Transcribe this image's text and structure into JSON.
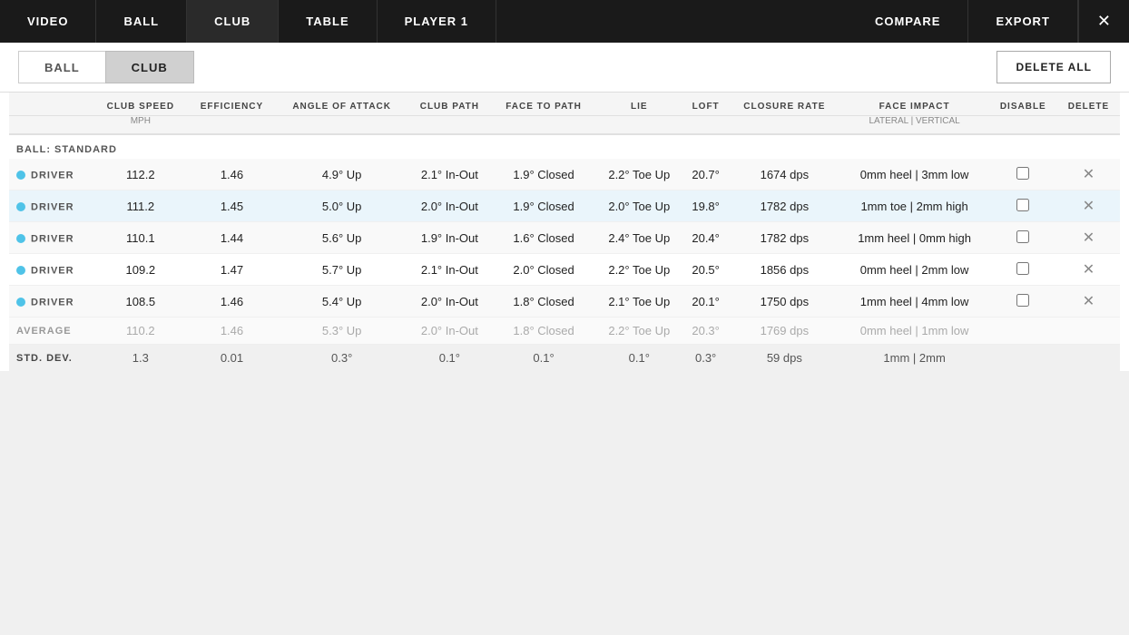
{
  "nav": {
    "items": [
      {
        "label": "VIDEO",
        "active": false
      },
      {
        "label": "BALL",
        "active": false
      },
      {
        "label": "CLUB",
        "active": true
      },
      {
        "label": "TABLE",
        "active": false
      },
      {
        "label": "PLAYER 1",
        "active": false
      }
    ],
    "right_items": [
      {
        "label": "COMPARE"
      },
      {
        "label": "EXPORT"
      }
    ],
    "close_symbol": "✕"
  },
  "sub_nav": {
    "tabs": [
      {
        "label": "BALL",
        "active": false
      },
      {
        "label": "CLUB",
        "active": true
      }
    ],
    "delete_all": "DELETE ALL"
  },
  "table": {
    "columns": [
      {
        "label": "",
        "unit": ""
      },
      {
        "label": "CLUB SPEED",
        "unit": "MPH"
      },
      {
        "label": "EFFICIENCY",
        "unit": ""
      },
      {
        "label": "ANGLE OF ATTACK",
        "unit": ""
      },
      {
        "label": "CLUB PATH",
        "unit": ""
      },
      {
        "label": "FACE TO PATH",
        "unit": ""
      },
      {
        "label": "LIE",
        "unit": ""
      },
      {
        "label": "LOFT",
        "unit": ""
      },
      {
        "label": "CLOSURE RATE",
        "unit": ""
      },
      {
        "label": "FACE IMPACT",
        "unit": "LATERAL | VERTICAL"
      },
      {
        "label": "DISABLE",
        "unit": ""
      },
      {
        "label": "DELETE",
        "unit": ""
      }
    ],
    "section_label": "BALL: STANDARD",
    "rows": [
      {
        "highlighted": false,
        "dot": true,
        "club": "DRIVER",
        "club_speed": "112.2",
        "efficiency": "1.46",
        "angle_of_attack": "4.9° Up",
        "club_path": "2.1° In-Out",
        "face_to_path": "1.9° Closed",
        "lie": "2.2° Toe Up",
        "loft": "20.7°",
        "closure_rate": "1674 dps",
        "face_impact": "0mm heel | 3mm low"
      },
      {
        "highlighted": true,
        "dot": true,
        "club": "DRIVER",
        "club_speed": "111.2",
        "efficiency": "1.45",
        "angle_of_attack": "5.0° Up",
        "club_path": "2.0° In-Out",
        "face_to_path": "1.9° Closed",
        "lie": "2.0° Toe Up",
        "loft": "19.8°",
        "closure_rate": "1782 dps",
        "face_impact": "1mm toe | 2mm high"
      },
      {
        "highlighted": false,
        "dot": true,
        "club": "DRIVER",
        "club_speed": "110.1",
        "efficiency": "1.44",
        "angle_of_attack": "5.6° Up",
        "club_path": "1.9° In-Out",
        "face_to_path": "1.6° Closed",
        "lie": "2.4° Toe Up",
        "loft": "20.4°",
        "closure_rate": "1782 dps",
        "face_impact": "1mm heel | 0mm high"
      },
      {
        "highlighted": false,
        "dot": true,
        "club": "DRIVER",
        "club_speed": "109.2",
        "efficiency": "1.47",
        "angle_of_attack": "5.7° Up",
        "club_path": "2.1° In-Out",
        "face_to_path": "2.0° Closed",
        "lie": "2.2° Toe Up",
        "loft": "20.5°",
        "closure_rate": "1856 dps",
        "face_impact": "0mm heel | 2mm low"
      },
      {
        "highlighted": false,
        "dot": true,
        "club": "DRIVER",
        "club_speed": "108.5",
        "efficiency": "1.46",
        "angle_of_attack": "5.4° Up",
        "club_path": "2.0° In-Out",
        "face_to_path": "1.8° Closed",
        "lie": "2.1° Toe Up",
        "loft": "20.1°",
        "closure_rate": "1750 dps",
        "face_impact": "1mm heel | 4mm low"
      }
    ],
    "average": {
      "label": "AVERAGE",
      "club_speed": "110.2",
      "efficiency": "1.46",
      "angle_of_attack": "5.3° Up",
      "club_path": "2.0° In-Out",
      "face_to_path": "1.8° Closed",
      "lie": "2.2° Toe Up",
      "loft": "20.3°",
      "closure_rate": "1769 dps",
      "face_impact": "0mm heel | 1mm low"
    },
    "std_dev": {
      "label": "STD. DEV.",
      "club_speed": "1.3",
      "efficiency": "0.01",
      "angle_of_attack": "0.3°",
      "club_path": "0.1°",
      "face_to_path": "0.1°",
      "lie": "0.1°",
      "loft": "0.3°",
      "closure_rate": "59 dps",
      "face_impact": "1mm | 2mm"
    }
  }
}
